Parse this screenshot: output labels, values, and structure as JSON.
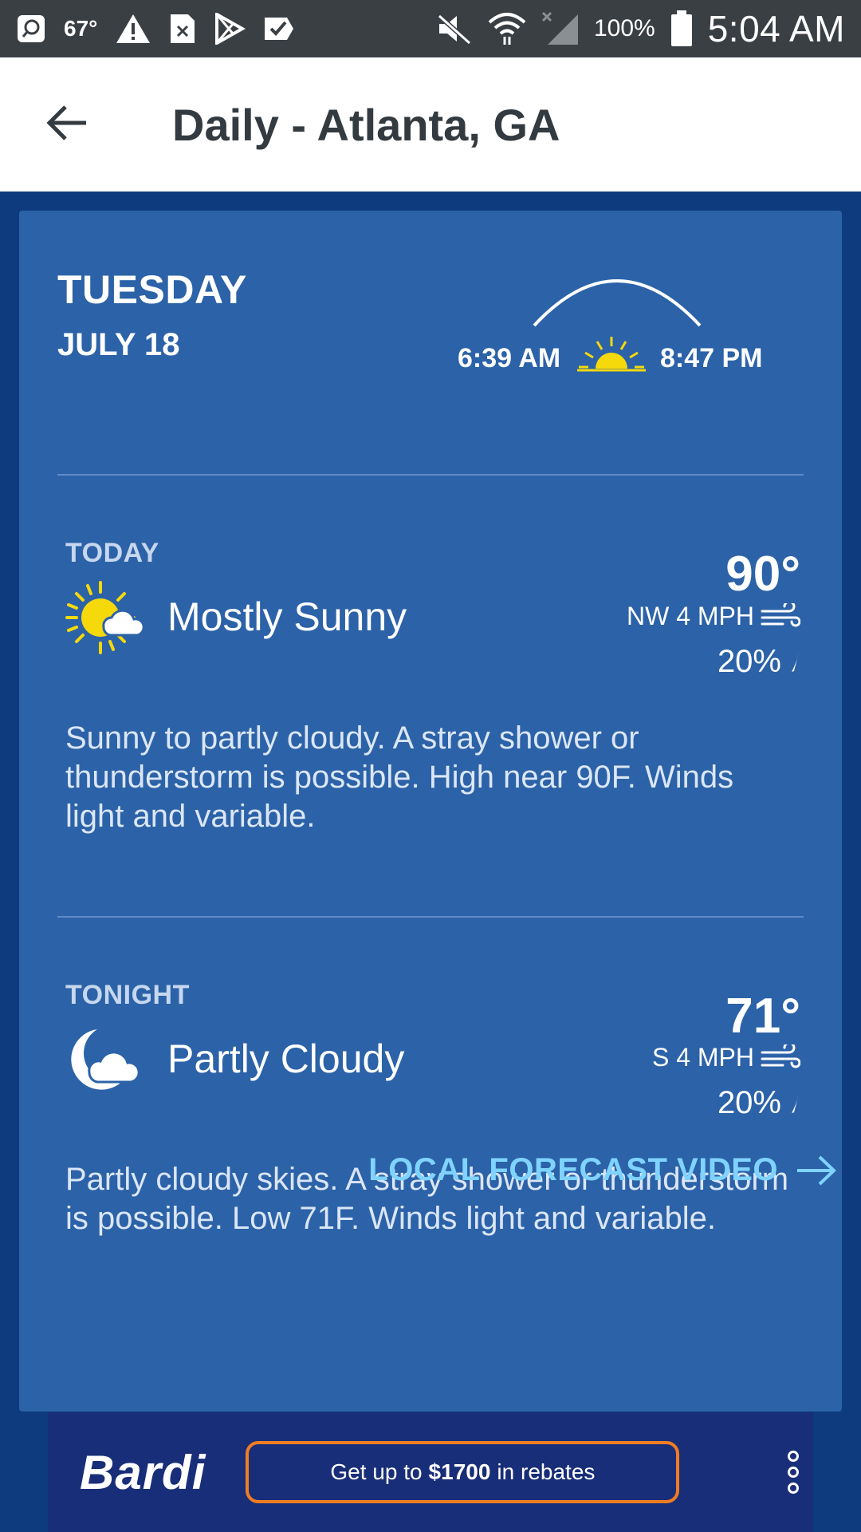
{
  "status_bar": {
    "temperature": "67°",
    "battery": "100%",
    "time": "5:04 AM"
  },
  "app_bar": {
    "title": "Daily - Atlanta, GA"
  },
  "day": {
    "name": "TUESDAY",
    "date": "JULY 18",
    "sunrise": "6:39 AM",
    "sunset": "8:47 PM"
  },
  "periods": [
    {
      "label": "TODAY",
      "condition": "Mostly Sunny",
      "icon": "mostly-sunny-icon",
      "temperature": "90°",
      "wind": "NW 4 MPH",
      "precip": "20%",
      "narrative": "Sunny to partly cloudy. A stray shower or thunderstorm is possible. High near 90F. Winds light and variable."
    },
    {
      "label": "TONIGHT",
      "condition": "Partly Cloudy",
      "icon": "partly-cloudy-night-icon",
      "temperature": "71°",
      "wind": "S 4 MPH",
      "precip": "20%",
      "narrative": "Partly cloudy skies. A stray shower or thunderstorm is possible. Low 71F. Winds light and variable."
    }
  ],
  "video_link": {
    "label": "LOCAL FORECAST VIDEO"
  },
  "ad": {
    "brand": "Bardi",
    "cta_prefix": "Get up to",
    "cta_amount": "$1700",
    "cta_suffix": "in rebates"
  },
  "colors": {
    "background": "#0d3b7d",
    "card": "#2c62a8",
    "link": "#7fd3ff",
    "sun": "#f5d90a",
    "ad_border": "#f07d22"
  }
}
